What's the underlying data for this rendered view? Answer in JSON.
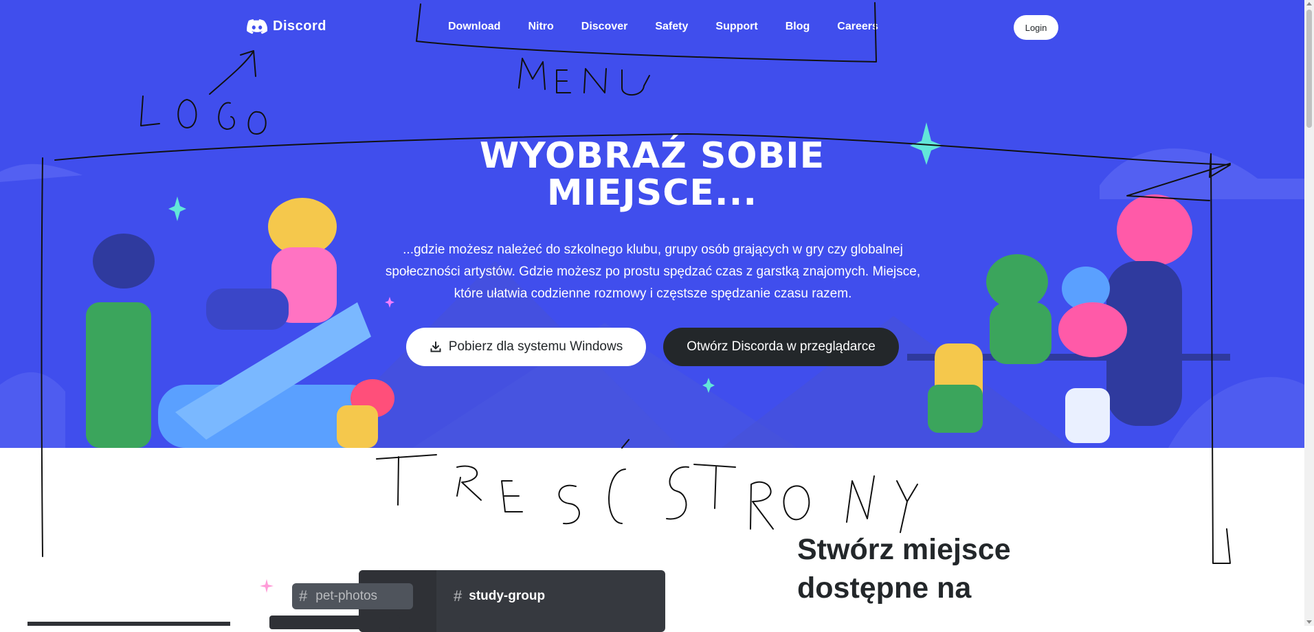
{
  "nav": {
    "logo_text": "Discord",
    "menu": [
      "Download",
      "Nitro",
      "Discover",
      "Safety",
      "Support",
      "Blog",
      "Careers"
    ],
    "login": "Login"
  },
  "hero": {
    "title_line1": "WYOBRAŹ SOBIE",
    "title_line2": "MIEJSCE...",
    "subtitle": "...gdzie możesz należeć do szkolnego klubu, grupy osób grających w gry czy globalnej społeczności artystów. Gdzie możesz po prostu spędzać czas z garstką znajomych. Miejsce, które ułatwia codzienne rozmowy i częstsze spędzanie czasu razem.",
    "btn_download": "Pobierz dla systemu Windows",
    "btn_browser": "Otwórz Discorda w przeglądarce"
  },
  "content": {
    "title": "Stwórz miejsce dostępne na",
    "channel_active": "study-group",
    "channel_pill": "pet-photos"
  },
  "annotations": {
    "logo": "LOGO",
    "menu": "MENU",
    "content": "TREŚĆ STRONY"
  },
  "colors": {
    "blurple": "#404eed",
    "dark": "#23272a",
    "white": "#ffffff"
  }
}
